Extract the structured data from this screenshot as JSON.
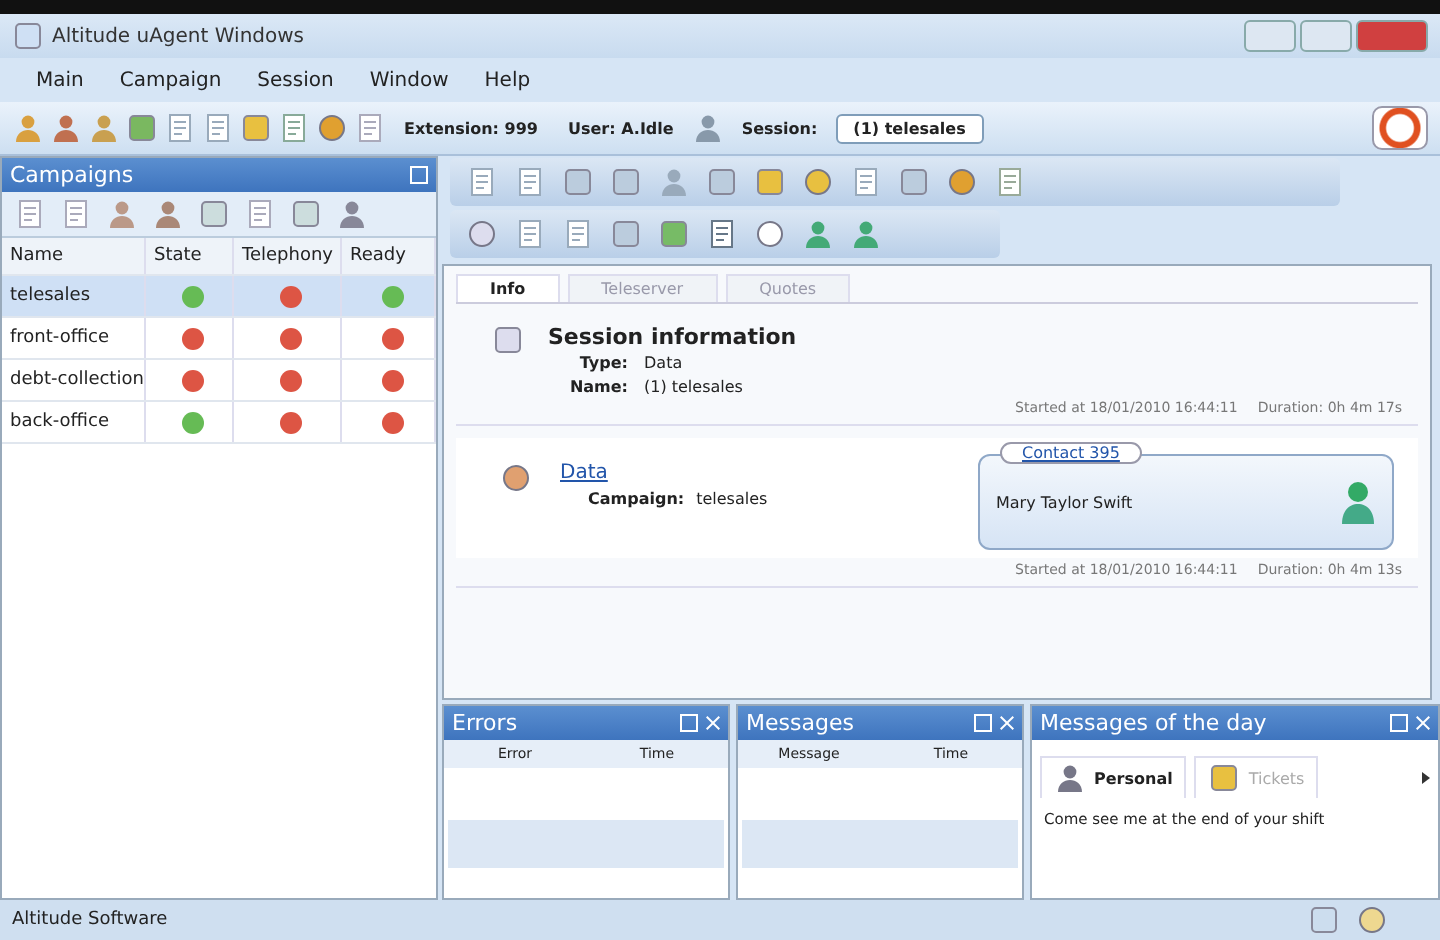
{
  "window": {
    "title": "Altitude uAgent Windows"
  },
  "menu": [
    "Main",
    "Campaign",
    "Session",
    "Window",
    "Help"
  ],
  "toolbar": {
    "extension": "Extension: 999",
    "user": "User: A.Idle",
    "session_label": "Session:",
    "session_value": "(1) telesales"
  },
  "campaigns": {
    "title": "Campaigns",
    "columns": [
      "Name",
      "State",
      "Telephony",
      "Ready"
    ],
    "rows": [
      {
        "name": "telesales",
        "selected": true,
        "state": {
          "color": "#66bb55"
        },
        "telephony": {
          "color": "#dd5544"
        },
        "ready": {
          "color": "#66bb55"
        }
      },
      {
        "name": "front-office",
        "selected": false,
        "state": {
          "color": "#dd5544"
        },
        "telephony": {
          "color": "#dd5544"
        },
        "ready": {
          "color": "#dd5544"
        }
      },
      {
        "name": "debt-collection",
        "selected": false,
        "state": {
          "color": "#dd5544"
        },
        "telephony": {
          "color": "#dd5544"
        },
        "ready": {
          "color": "#dd5544"
        }
      },
      {
        "name": "back-office",
        "selected": false,
        "state": {
          "color": "#66bb55"
        },
        "telephony": {
          "color": "#dd5544"
        },
        "ready": {
          "color": "#dd5544"
        }
      }
    ]
  },
  "tabs": [
    {
      "label": "Info",
      "selected": true
    },
    {
      "label": "Teleserver",
      "selected": false
    },
    {
      "label": "Quotes",
      "selected": false
    }
  ],
  "session": {
    "title": "Session information",
    "type_label": "Type:",
    "type": "Data",
    "name_label": "Name:",
    "name": "(1) telesales",
    "started": "Started at 18/01/2010 16:44:11",
    "duration": "Duration: 0h 4m 17s"
  },
  "data": {
    "link": "Data",
    "campaign_label": "Campaign:",
    "campaign": "telesales",
    "contact_title": "Contact 395",
    "contact_name": "Mary Taylor Swift",
    "started": "Started at 18/01/2010 16:44:11",
    "duration": "Duration: 0h 4m 13s"
  },
  "errors": {
    "title": "Errors",
    "columns": [
      "Error",
      "Time"
    ]
  },
  "messages": {
    "title": "Messages",
    "columns": [
      "Message",
      "Time"
    ]
  },
  "motd": {
    "title": "Messages of the day",
    "tabs": [
      {
        "label": "Personal",
        "selected": true
      },
      {
        "label": "Tickets",
        "selected": false
      }
    ],
    "text": "Come see me at the end of your shift"
  },
  "status_bar": "Altitude Software"
}
